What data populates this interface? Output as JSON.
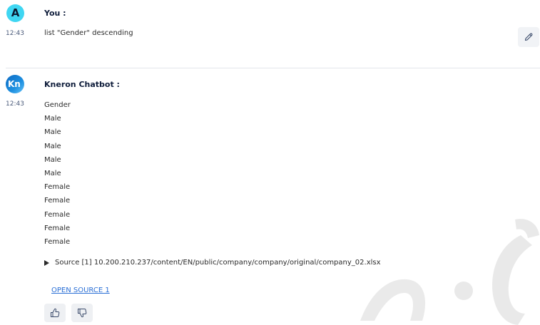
{
  "user_message": {
    "avatar_letter": "A",
    "sender": "You :",
    "time": "12:43",
    "text": "list \"Gender\" descending"
  },
  "bot_message": {
    "avatar_text": "Kn",
    "sender": "Kneron Chatbot :",
    "time": "12:43",
    "results": [
      "Gender",
      "Male",
      "Male",
      "Male",
      "Male",
      "Male",
      "Female",
      "Female",
      "Female",
      "Female",
      "Female"
    ],
    "source": "Source [1] 10.200.210.237/content/EN/public/company/company/original/company_02.xlsx",
    "open_source_label": "OPEN SOURCE 1"
  },
  "icons": {
    "edit": "pencil-icon",
    "like": "thumbs-up-icon",
    "dislike": "thumbs-down-icon",
    "source_toggle": "triangle-right-icon"
  },
  "colors": {
    "user_avatar": "#3fd6f2",
    "bot_avatar": "#1d8fe0",
    "link": "#2a6fd6",
    "watermark": "#1a1a1a"
  }
}
